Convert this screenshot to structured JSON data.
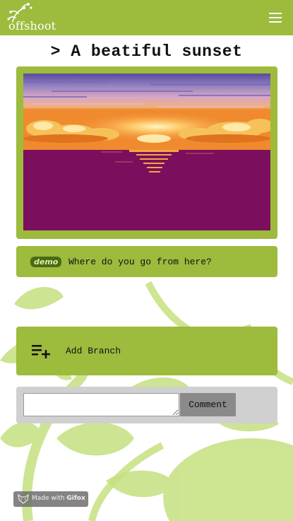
{
  "header": {
    "brand": "offshoot",
    "menu_icon": "hamburger-menu-icon",
    "color": "#9dbb3d"
  },
  "page": {
    "title": "> A beatiful sunset"
  },
  "story": {
    "image_description": "pixel-art sunset over the sea",
    "prompt_badge": "demo",
    "prompt_text": "Where do you go from here?"
  },
  "branch": {
    "label": "Add Branch",
    "icon": "playlist-add-icon"
  },
  "comment": {
    "input_value": "",
    "button_label": "Comment"
  },
  "watermark": {
    "prefix": "Made with",
    "brand": "Gifox"
  },
  "colors": {
    "accent": "#9dbb3d",
    "badge": "#4a6a14",
    "comment_bg": "#d0d0d0",
    "comment_button": "#8a8a8a"
  }
}
